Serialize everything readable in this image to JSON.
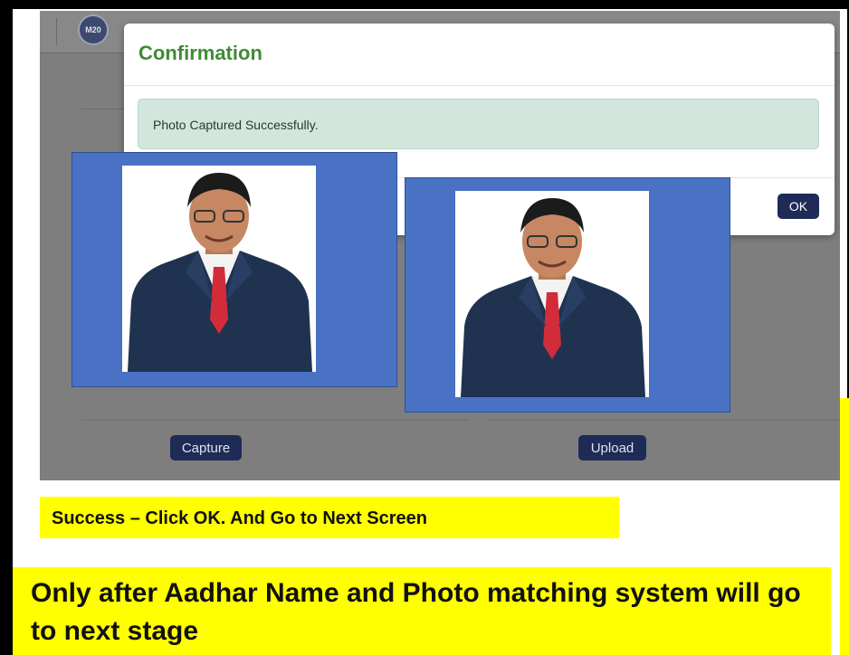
{
  "header": {
    "logo_text": "M20"
  },
  "dialog": {
    "title": "Confirmation",
    "message": "Photo Captured Successfully.",
    "ok_label": "OK"
  },
  "actions": {
    "capture_label": "Capture",
    "upload_label": "Upload"
  },
  "annotations": {
    "success_note": "Success – Click OK. And Go to Next Screen",
    "stage_note": "Only after Aadhar Name and Photo matching system will go to next stage"
  },
  "colors": {
    "dialog_title": "#3f8b36",
    "alert_bg": "#d3e6dd",
    "button_bg": "#1f2b57",
    "photo_frame": "#4a72c4",
    "highlight": "#ffff00"
  }
}
